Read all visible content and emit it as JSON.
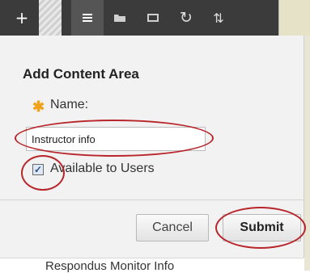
{
  "toolbar": {
    "add_icon": "plus-icon",
    "list_icon": "list-icon",
    "folder_icon": "folder-icon",
    "window_icon": "window-icon",
    "refresh_icon": "refresh-icon",
    "sort_icon": "sort-arrows-icon"
  },
  "dialog": {
    "title": "Add Content Area",
    "required_marker": "✱",
    "name_label": "Name:",
    "name_value": "Instructor info",
    "available_label": "Available to Users",
    "available_checked": true,
    "cancel_label": "Cancel",
    "submit_label": "Submit"
  },
  "below": {
    "menu_item_text": "Respondus Monitor Info"
  },
  "colors": {
    "toolbar_bg": "#3b3b3b",
    "dialog_bg": "#f2f2f2",
    "required_star": "#f2a11a",
    "annotation_red": "#b8262b"
  }
}
